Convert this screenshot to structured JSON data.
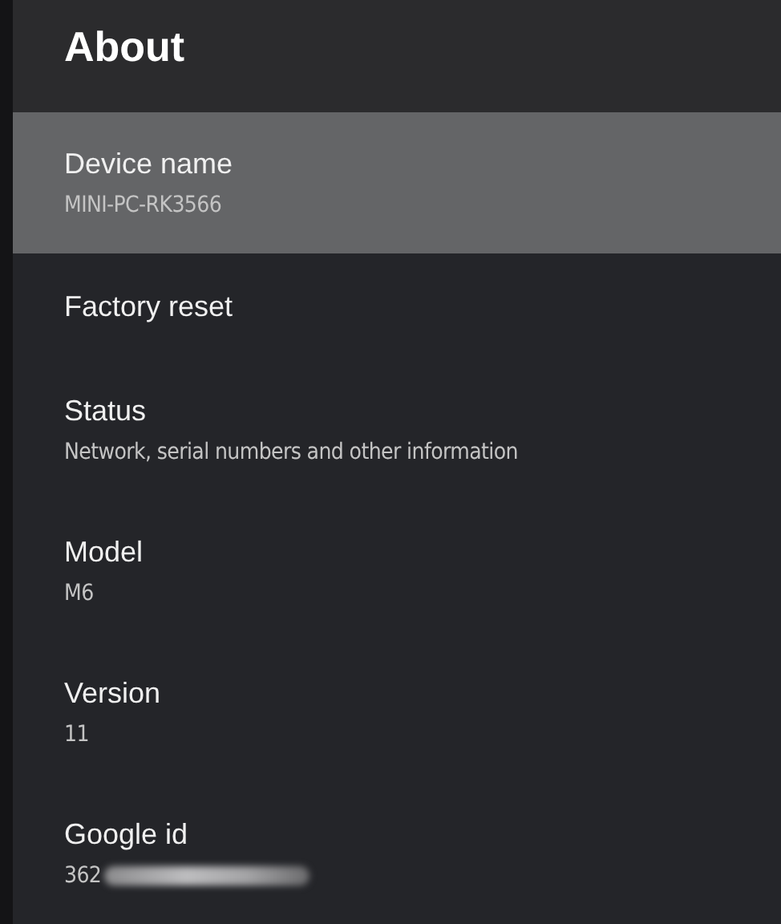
{
  "header": {
    "title": "About"
  },
  "items": [
    {
      "title": "Device name",
      "subtitle": "MINI-PC-RK3566",
      "selected": true
    },
    {
      "title": "Factory reset",
      "selected": false
    },
    {
      "title": "Status",
      "subtitle": "Network, serial numbers and other information",
      "selected": false
    },
    {
      "title": "Model",
      "subtitle": "M6",
      "selected": false
    },
    {
      "title": "Version",
      "subtitle": "11",
      "selected": false
    },
    {
      "title": "Google id",
      "subtitle": "362",
      "redacted": true,
      "selected": false
    }
  ]
}
